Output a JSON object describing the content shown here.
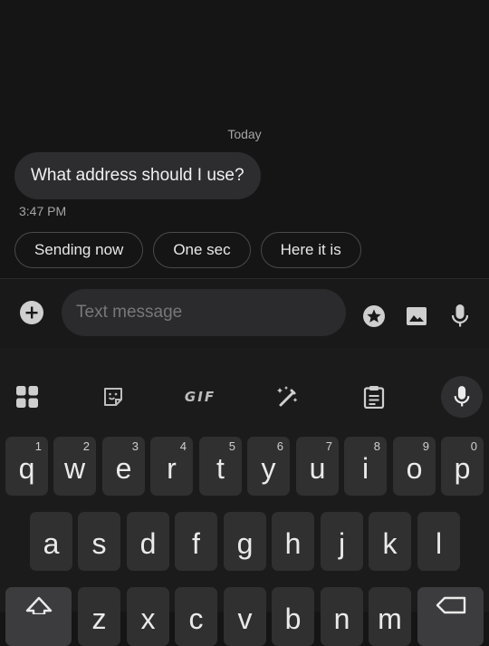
{
  "conversation": {
    "date_divider": "Today",
    "message_text": "What address should I use?",
    "message_time": "3:47 PM"
  },
  "smart_replies": [
    "Sending now",
    "One sec",
    "Here it is"
  ],
  "compose": {
    "placeholder": "Text message",
    "add_icon": "plus-circle-icon",
    "star_icon": "star-icon",
    "image_icon": "image-icon",
    "mic_icon": "mic-icon"
  },
  "keyboard": {
    "toolbar": {
      "apps_icon": "apps-grid-icon",
      "sticker_icon": "sticker-icon",
      "gif_label": "GIF",
      "magic_icon": "magic-wand-icon",
      "clipboard_icon": "clipboard-icon",
      "voice_icon": "mic-icon"
    },
    "row1": [
      {
        "char": "q",
        "hint": "1"
      },
      {
        "char": "w",
        "hint": "2"
      },
      {
        "char": "e",
        "hint": "3"
      },
      {
        "char": "r",
        "hint": "4"
      },
      {
        "char": "t",
        "hint": "5"
      },
      {
        "char": "y",
        "hint": "6"
      },
      {
        "char": "u",
        "hint": "7"
      },
      {
        "char": "i",
        "hint": "8"
      },
      {
        "char": "o",
        "hint": "9"
      },
      {
        "char": "p",
        "hint": "0"
      }
    ],
    "row2": [
      "a",
      "s",
      "d",
      "f",
      "g",
      "h",
      "j",
      "k",
      "l"
    ],
    "row3": [
      "z",
      "x",
      "c",
      "v",
      "b",
      "n",
      "m"
    ]
  },
  "colors": {
    "background": "#151515",
    "bubble": "#2d2d2f",
    "key": "#303030",
    "keyboard": "#1b1b1b"
  }
}
